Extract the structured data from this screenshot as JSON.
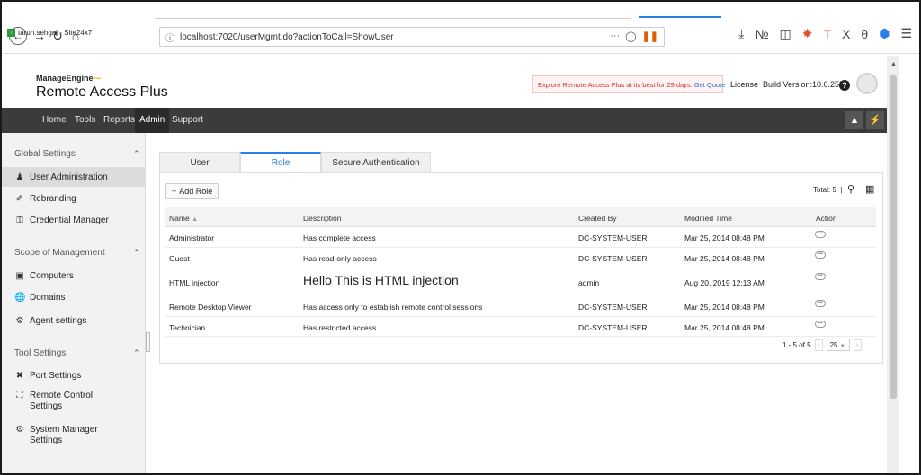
{
  "browser": {
    "url": "localhost:7020/userMgmt.do?actionToCall=ShowUser",
    "url_actions": "···",
    "bookmark": "tarun.sehgal - Site24x7"
  },
  "header": {
    "logo_small": "ManageEngine",
    "logo_main": "Remote Access",
    "logo_bold": "Plus",
    "promo_text": "Explore Remote Access Plus at its best for 29 days.",
    "promo_link": "Get Quote",
    "license": "License",
    "build": "Build Version:10.0.259"
  },
  "topnav": {
    "items": [
      "Home",
      "Tools",
      "Reports",
      "Admin",
      "Support"
    ],
    "active": "Admin"
  },
  "sidebar": {
    "sections": [
      {
        "label": "Global Settings",
        "items": [
          "User Administration",
          "Rebranding",
          "Credential Manager"
        ]
      },
      {
        "label": "Scope of Management",
        "items": [
          "Computers",
          "Domains",
          "Agent settings"
        ]
      },
      {
        "label": "Tool Settings",
        "items": [
          "Port Settings",
          "Remote Control Settings",
          "System Manager Settings"
        ]
      }
    ],
    "active_item": "User Administration"
  },
  "tabs": [
    "User",
    "Role",
    "Secure Authentication"
  ],
  "active_tab": "Role",
  "toolbar": {
    "add_label": "Add Role",
    "total": "Total: 5"
  },
  "table": {
    "columns": [
      "Name",
      "Description",
      "Created By",
      "Modified Time",
      "Action"
    ],
    "rows": [
      {
        "name": "Administrator",
        "description": "Has complete access",
        "created_by": "DC-SYSTEM-USER",
        "modified": "Mar 25, 2014 08:48 PM"
      },
      {
        "name": "Guest",
        "description": "Has read-only access",
        "created_by": "DC-SYSTEM-USER",
        "modified": "Mar 25, 2014 08:48 PM"
      },
      {
        "name": "HTML injection",
        "description": "Hello This is HTML injection",
        "created_by": "admin",
        "modified": "Aug 20, 2019 12:13 AM"
      },
      {
        "name": "Remote Desktop Viewer",
        "description": "Has access only to establish remote control sessions",
        "created_by": "DC-SYSTEM-USER",
        "modified": "Mar 25, 2014 08:48 PM"
      },
      {
        "name": "Technician",
        "description": "Has restricted access",
        "created_by": "DC-SYSTEM-USER",
        "modified": "Mar 25, 2014 08:48 PM"
      }
    ]
  },
  "pager": {
    "range": "1 - 5 of 5",
    "page_size": "25"
  },
  "colors": {
    "accent": "#2a7ee8",
    "nav_bg": "#3b3b3b",
    "promo_text": "#d73030"
  }
}
